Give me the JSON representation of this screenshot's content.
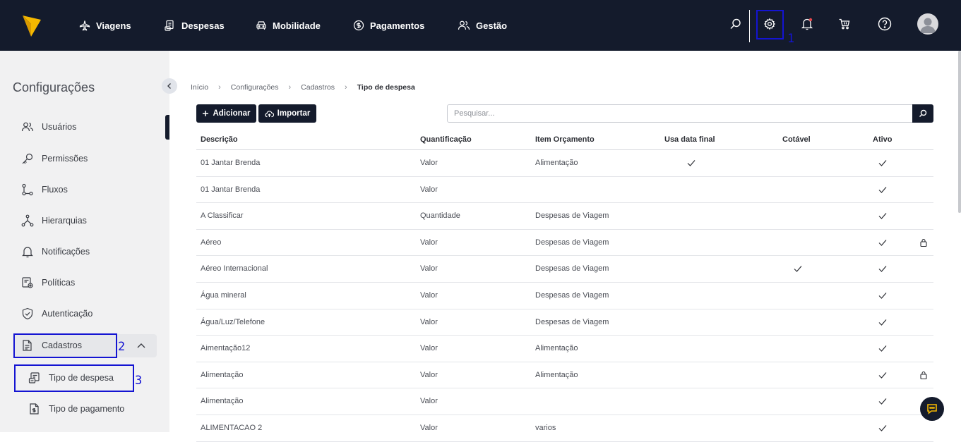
{
  "topnav": {
    "items": [
      {
        "label": "Viagens",
        "icon": "airplane-icon"
      },
      {
        "label": "Despesas",
        "icon": "receipt-icon"
      },
      {
        "label": "Mobilidade",
        "icon": "car-icon"
      },
      {
        "label": "Pagamentos",
        "icon": "dollar-icon"
      },
      {
        "label": "Gestão",
        "icon": "users-icon"
      }
    ],
    "highlight_1": "1"
  },
  "sidebar": {
    "title": "Configurações",
    "items": [
      {
        "label": "Usuários"
      },
      {
        "label": "Permissões"
      },
      {
        "label": "Fluxos"
      },
      {
        "label": "Hierarquias"
      },
      {
        "label": "Notificações"
      },
      {
        "label": "Políticas"
      },
      {
        "label": "Autenticação"
      },
      {
        "label": "Cadastros"
      }
    ],
    "sub_items": [
      {
        "label": "Tipo de despesa"
      },
      {
        "label": "Tipo de pagamento"
      }
    ],
    "highlight_2": "2",
    "highlight_3": "3"
  },
  "breadcrumb": {
    "items": [
      "Início",
      "Configurações",
      "Cadastros"
    ],
    "current": "Tipo de despesa"
  },
  "toolbar": {
    "add_label": "Adicionar",
    "import_label": "Importar",
    "search_placeholder": "Pesquisar..."
  },
  "table": {
    "columns": [
      "Descrição",
      "Quantificação",
      "Item Orçamento",
      "Usa data final",
      "Cotável",
      "Ativo"
    ],
    "rows": [
      {
        "descricao": "01 Jantar Brenda",
        "quantificacao": "Valor",
        "item": "Alimentação",
        "data_final": true,
        "cotavel": false,
        "ativo": true,
        "locked": false
      },
      {
        "descricao": "01 Jantar Brenda",
        "quantificacao": "Valor",
        "item": "",
        "data_final": false,
        "cotavel": false,
        "ativo": true,
        "locked": false
      },
      {
        "descricao": "A Classificar",
        "quantificacao": "Quantidade",
        "item": "Despesas de Viagem",
        "data_final": false,
        "cotavel": false,
        "ativo": true,
        "locked": false
      },
      {
        "descricao": "Aéreo",
        "quantificacao": "Valor",
        "item": "Despesas de Viagem",
        "data_final": false,
        "cotavel": false,
        "ativo": true,
        "locked": true
      },
      {
        "descricao": "Aéreo Internacional",
        "quantificacao": "Valor",
        "item": "Despesas de Viagem",
        "data_final": false,
        "cotavel": true,
        "ativo": true,
        "locked": false
      },
      {
        "descricao": "Água mineral",
        "quantificacao": "Valor",
        "item": "Despesas de Viagem",
        "data_final": false,
        "cotavel": false,
        "ativo": true,
        "locked": false
      },
      {
        "descricao": "Água/Luz/Telefone",
        "quantificacao": "Valor",
        "item": "Despesas de Viagem",
        "data_final": false,
        "cotavel": false,
        "ativo": true,
        "locked": false
      },
      {
        "descricao": "Aimentação12",
        "quantificacao": "Valor",
        "item": "Alimentação",
        "data_final": false,
        "cotavel": false,
        "ativo": true,
        "locked": false
      },
      {
        "descricao": "Alimentação",
        "quantificacao": "Valor",
        "item": "Alimentação",
        "data_final": false,
        "cotavel": false,
        "ativo": true,
        "locked": true
      },
      {
        "descricao": "Alimentação",
        "quantificacao": "Valor",
        "item": "",
        "data_final": false,
        "cotavel": false,
        "ativo": true,
        "locked": false
      },
      {
        "descricao": "ALIMENTACAO 2",
        "quantificacao": "Valor",
        "item": "varios",
        "data_final": false,
        "cotavel": false,
        "ativo": true,
        "locked": false
      }
    ]
  },
  "colors": {
    "navy": "#141b2c",
    "highlight": "#1414d2",
    "notification_dot": "#e5484d"
  }
}
